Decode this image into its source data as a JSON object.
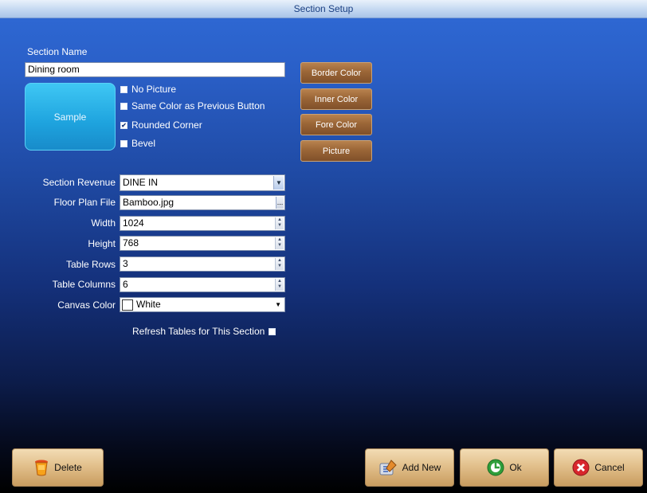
{
  "window": {
    "title": "Section Setup"
  },
  "section_name": {
    "label": "Section Name",
    "value": "Dining room"
  },
  "sample": {
    "label": "Sample"
  },
  "options": [
    {
      "label": "No Picture",
      "checked": false
    },
    {
      "label": "Same Color as Previous Button",
      "checked": false
    },
    {
      "label": "Rounded Corner",
      "checked": true
    },
    {
      "label": "Bevel",
      "checked": false
    }
  ],
  "color_buttons": {
    "border": "Border Color",
    "inner": "Inner Color",
    "fore": "Fore Color",
    "picture": "Picture"
  },
  "fields": {
    "section_revenue": {
      "label": "Section Revenue",
      "value": "DINE IN"
    },
    "floor_plan_file": {
      "label": "Floor Plan File",
      "value": "Bamboo.jpg",
      "browse": "..."
    },
    "width": {
      "label": "Width",
      "value": "1024"
    },
    "height": {
      "label": "Height",
      "value": "768"
    },
    "table_rows": {
      "label": "Table Rows",
      "value": "3"
    },
    "table_columns": {
      "label": "Table Columns",
      "value": "6"
    },
    "canvas_color": {
      "label": "Canvas Color",
      "value": "White",
      "swatch": "#ffffff"
    }
  },
  "refresh": {
    "label": "Refresh Tables for This Section",
    "checked": false
  },
  "actions": {
    "delete": "Delete",
    "add_new": "Add New",
    "ok": "Ok",
    "cancel": "Cancel"
  },
  "colors": {
    "titlebar_text": "#1a3f82",
    "button_brown": "#9b6637",
    "button_tan": "#e2c08c",
    "sample_blue": "#1ea3de"
  }
}
